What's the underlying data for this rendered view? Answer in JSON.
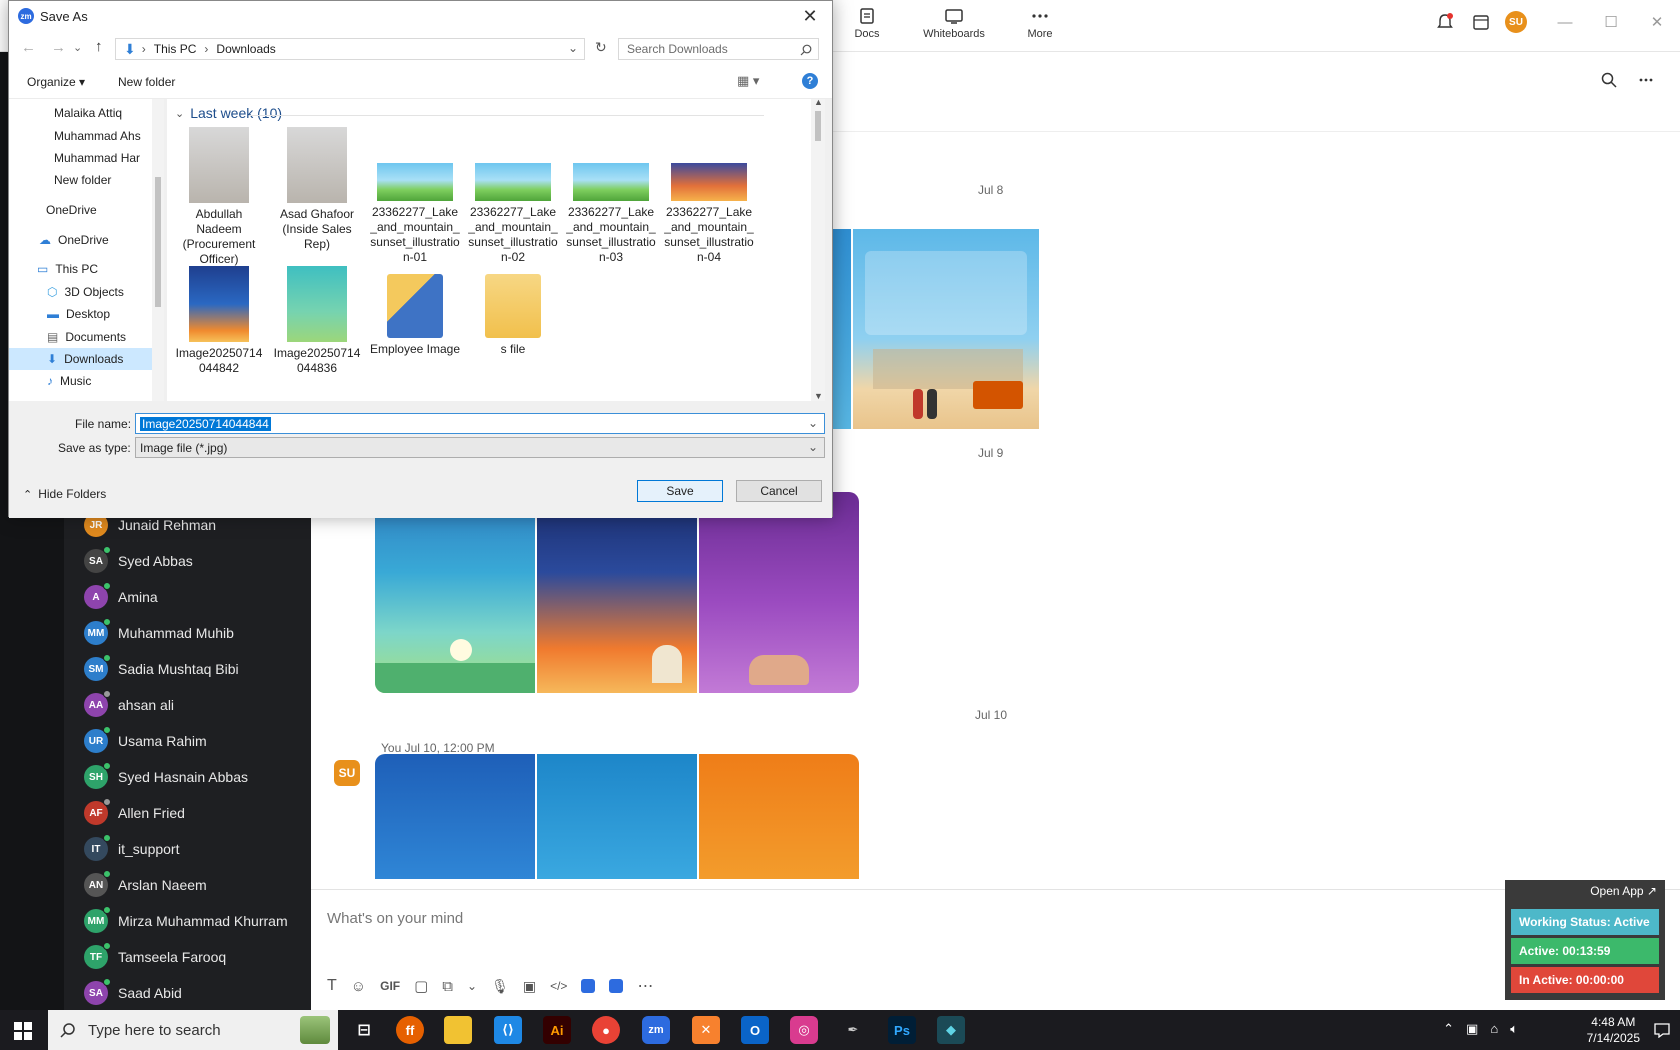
{
  "topbar": {
    "tools": [
      {
        "label": "Docs",
        "icon": "docs-icon"
      },
      {
        "label": "Whiteboards",
        "icon": "whiteboard-icon"
      },
      {
        "label": "More",
        "icon": "more-icon"
      }
    ],
    "user_initials": "SU"
  },
  "contacts": [
    {
      "name": "Junaid Rehman",
      "initials": "JR",
      "color": "#e08a1e",
      "status": "#e08a1e"
    },
    {
      "name": "Syed Abbas",
      "initials": "SA",
      "color": "#444",
      "status": "#3cc26b"
    },
    {
      "name": "Amina",
      "initials": "A",
      "color": "#8e44ad",
      "status": "#3cc26b"
    },
    {
      "name": "Muhammad Muhib",
      "initials": "MM",
      "color": "#2d7ecb",
      "status": "#3cc26b"
    },
    {
      "name": "Sadia Mushtaq Bibi",
      "initials": "SM",
      "color": "#2d7ecb",
      "status": "#3cc26b"
    },
    {
      "name": "ahsan ali",
      "initials": "AA",
      "color": "#8e44ad",
      "status": "#999"
    },
    {
      "name": "Usama Rahim",
      "initials": "UR",
      "color": "#2d7ecb",
      "status": "#3cc26b"
    },
    {
      "name": "Syed Hasnain Abbas",
      "initials": "SH",
      "color": "#2ea36a",
      "status": "#3cc26b"
    },
    {
      "name": "Allen Fried",
      "initials": "AF",
      "color": "#c0392b",
      "status": "#999"
    },
    {
      "name": "it_support",
      "initials": "IT",
      "color": "#34495e",
      "status": "#3cc26b"
    },
    {
      "name": "Arslan Naeem",
      "initials": "AN",
      "color": "#555",
      "status": "#3cc26b"
    },
    {
      "name": "Mirza Muhammad Khurram",
      "initials": "MM",
      "color": "#2ea36a",
      "status": "#3cc26b"
    },
    {
      "name": "Tamseela Farooq",
      "initials": "TF",
      "color": "#2ea36a",
      "status": "#3cc26b"
    },
    {
      "name": "Saad Abid",
      "initials": "SA",
      "color": "#8e44ad",
      "status": "#3cc26b"
    }
  ],
  "chat": {
    "dates": [
      "Jul 8",
      "Jul 9",
      "Jul 10"
    ],
    "msg_meta": "You Jul 10, 12:00 PM",
    "composer_placeholder": "What's on your mind"
  },
  "status_widget": {
    "open_app": "Open App ↗",
    "working": "Working Status: Active",
    "active": "Active: 00:13:59",
    "inactive": "In Active: 00:00:00"
  },
  "taskbar": {
    "search_placeholder": "Type here to search",
    "time": "4:48 AM",
    "date": "7/14/2025"
  },
  "dialog": {
    "title": "Save As",
    "path": [
      "This PC",
      "Downloads"
    ],
    "search_placeholder": "Search Downloads",
    "organize": "Organize",
    "new_folder": "New folder",
    "group_header": "Last week (10)",
    "tree": [
      {
        "label": "Malaika Attiq",
        "type": "folder"
      },
      {
        "label": "Muhammad Ahs",
        "type": "folder"
      },
      {
        "label": "Muhammad Har",
        "type": "folder"
      },
      {
        "label": "New folder",
        "type": "folder"
      },
      {
        "label": "OneDrive",
        "type": "folder"
      },
      {
        "label": "OneDrive",
        "type": "cloud"
      },
      {
        "label": "This PC",
        "type": "pc"
      },
      {
        "label": "3D Objects",
        "type": "3d"
      },
      {
        "label": "Desktop",
        "type": "desktop"
      },
      {
        "label": "Documents",
        "type": "docs"
      },
      {
        "label": "Downloads",
        "type": "downloads"
      },
      {
        "label": "Music",
        "type": "music"
      }
    ],
    "files": [
      {
        "name": "Abdullah Nadeem (Procurement Officer)",
        "kind": "photo"
      },
      {
        "name": "Asad Ghafoor (Inside Sales Rep)",
        "kind": "photo"
      },
      {
        "name": "23362277_Lake_and_mountain_sunset_illustration-01",
        "kind": "landscape"
      },
      {
        "name": "23362277_Lake_and_mountain_sunset_illustration-02",
        "kind": "landscape"
      },
      {
        "name": "23362277_Lake_and_mountain_sunset_illustration-03",
        "kind": "landscape"
      },
      {
        "name": "23362277_Lake_and_mountain_sunset_illustration-04",
        "kind": "sunset"
      },
      {
        "name": "Image20250714044842",
        "kind": "poster-blue"
      },
      {
        "name": "Image20250714044836",
        "kind": "poster-teal"
      },
      {
        "name": "Employee Image",
        "kind": "folder-img"
      },
      {
        "name": "s file",
        "kind": "folder"
      }
    ],
    "file_name_label": "File name:",
    "file_name_value": "Image20250714044844",
    "save_type_label": "Save as type:",
    "save_type_value": "Image file (*.jpg)",
    "hide_folders": "Hide Folders",
    "save": "Save",
    "cancel": "Cancel"
  }
}
